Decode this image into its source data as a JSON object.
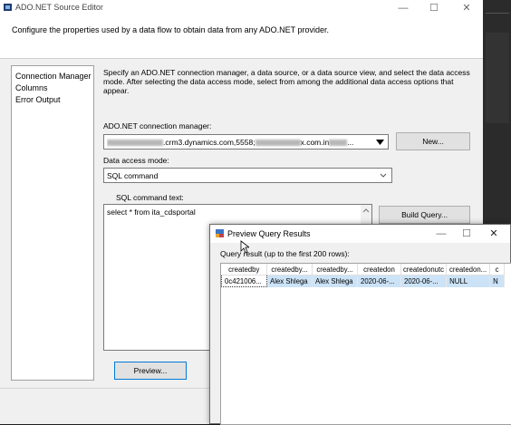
{
  "window": {
    "title": "ADO.NET Source Editor",
    "header_text": "Configure the properties used by a data flow to obtain data from any ADO.NET provider.",
    "minimize_glyph": "—",
    "maximize_glyph": "☐",
    "close_glyph": "✕"
  },
  "nav": {
    "items": [
      {
        "label": "Connection Manager",
        "selected": true
      },
      {
        "label": "Columns",
        "selected": false
      },
      {
        "label": "Error Output",
        "selected": false
      }
    ]
  },
  "connection": {
    "description": "Specify an ADO.NET connection manager, a data source, or a data source view, and select the data access mode. After selecting the data access mode, select from among the additional data access options that appear.",
    "manager_label": "ADO.NET connection manager:",
    "manager_value_part1": ".crm3.dynamics.com,5558;",
    "manager_value_part2": "x.com.in",
    "manager_value_part3": "...",
    "new_button": "New...",
    "access_mode_label": "Data access mode:",
    "access_mode_value": "SQL command",
    "sql_label": "SQL command text:",
    "sql_text": "select * from ita_cdsportal",
    "build_query_button": "Build Query...",
    "preview_button": "Preview..."
  },
  "preview": {
    "title": "Preview Query Results",
    "result_label": "Query result (up to the first 200 rows):",
    "columns": [
      "createdby",
      "createdby...",
      "createdby...",
      "createdon",
      "createdonutc",
      "createdon...",
      "c"
    ],
    "rows": [
      [
        "0c421006...",
        "Alex Shlega",
        "Alex Shlega",
        "2020-06-...",
        "2020-06-...",
        "NULL",
        "N"
      ]
    ]
  }
}
